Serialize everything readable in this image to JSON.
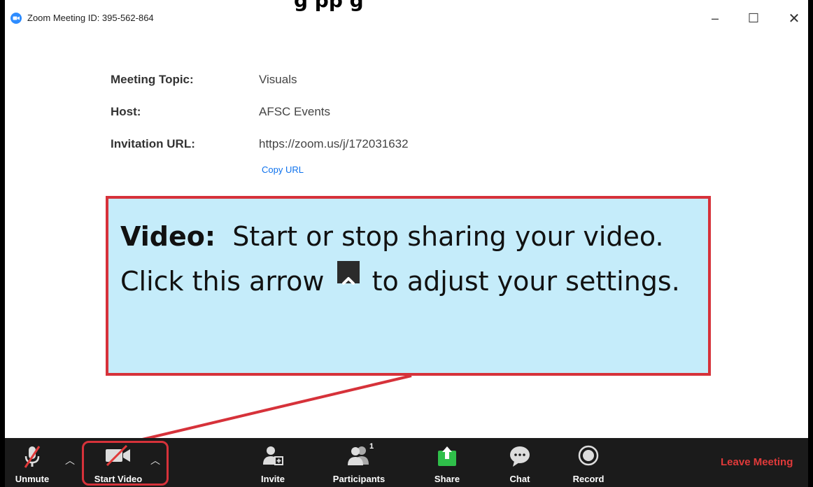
{
  "page_heading_partial": "g    pp g",
  "window": {
    "title": "Zoom Meeting ID: 395-562-864",
    "minimize_glyph": "–",
    "maximize_glyph": "☐",
    "close_glyph": "✕"
  },
  "meeting": {
    "topic_label": "Meeting Topic:",
    "topic_value": "Visuals",
    "host_label": "Host:",
    "host_value": "AFSC Events",
    "url_label": "Invitation URL:",
    "url_value": "https://zoom.us/j/172031632",
    "copy_url": "Copy URL"
  },
  "callout": {
    "term": "Video:",
    "text_before": "Start or stop sharing your video. Click this arrow",
    "text_after": "to adjust your settings."
  },
  "toolbar": {
    "unmute": "Unmute",
    "start_video": "Start Video",
    "invite": "Invite",
    "participants": "Participants",
    "participants_count": "1",
    "share": "Share",
    "chat": "Chat",
    "record": "Record",
    "leave": "Leave Meeting"
  },
  "icons": [
    "zoom-logo-icon",
    "microphone-muted-icon",
    "caret-up-icon",
    "video-off-icon",
    "invite-icon",
    "participants-icon",
    "share-icon",
    "chat-icon",
    "record-icon",
    "chevron-up-icon"
  ],
  "colors": {
    "callout_fill": "#c5ecfa",
    "callout_border": "#d6323a",
    "toolbar_bg": "#1b1b1b",
    "share_green": "#2fbf4a",
    "link_blue": "#0e72ed",
    "leave_red": "#e03a3a"
  }
}
